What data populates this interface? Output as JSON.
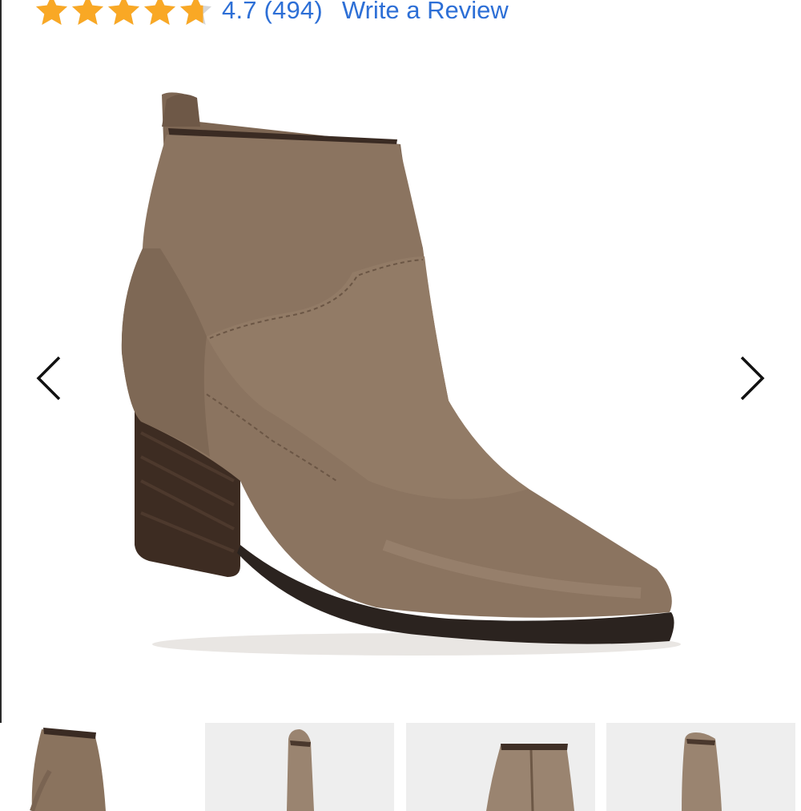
{
  "product": {
    "rating": {
      "score_text": "4.7",
      "count_text": "(494)",
      "stars_value": 4.7,
      "stars_max": 5,
      "star_color": "#f9a825",
      "star_empty_color": "#d6d6d6"
    },
    "review_link_label": "Write a Review",
    "link_color": "#2d6fd6",
    "main_image": {
      "icon": "ankle-boot-image",
      "color": "#8a735e"
    },
    "gallery": {
      "prev_icon": "chevron-left-icon",
      "next_icon": "chevron-right-icon",
      "thumbnails": [
        {
          "view": "side",
          "active": true
        },
        {
          "view": "heel",
          "active": false
        },
        {
          "view": "inner-side-zipper",
          "active": false
        },
        {
          "view": "back",
          "active": false
        }
      ]
    }
  }
}
